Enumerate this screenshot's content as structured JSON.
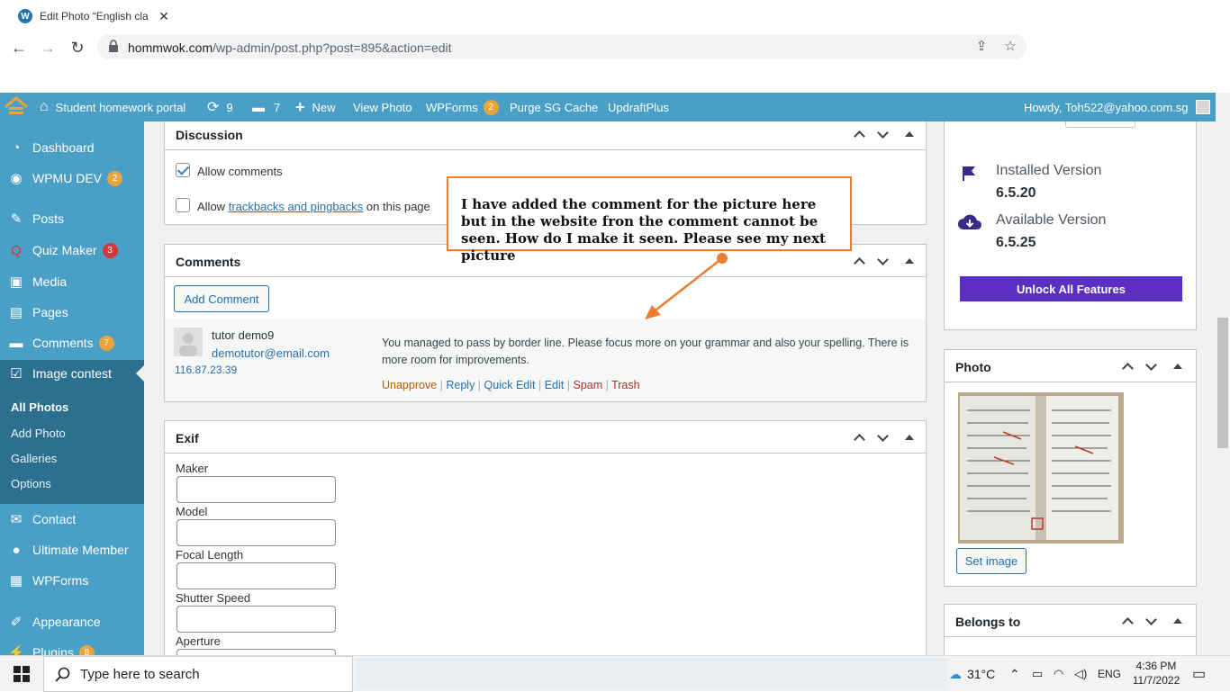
{
  "browser": {
    "tab_title": "Edit Photo “English cla",
    "url_host": "hommwok.com",
    "url_path": "/wp-admin/post.php?post=895&action=edit"
  },
  "adminbar": {
    "site_name": "Student homework portal",
    "updates_count": "9",
    "comments_count": "7",
    "new_label": "New",
    "view_photo": "View Photo",
    "wpforms": "WPForms",
    "wpforms_badge": "2",
    "purge": "Purge SG Cache",
    "updraft": "UpdraftPlus",
    "howdy": "Howdy, Toh522@yahoo.com.sg"
  },
  "sidebar": {
    "items": [
      {
        "label": "Dashboard",
        "icon": "dashboard-icon"
      },
      {
        "label": "WPMU DEV",
        "icon": "wpmudev-icon",
        "badge": "2"
      },
      {
        "label": "Posts",
        "icon": "pin-icon"
      },
      {
        "label": "Quiz Maker",
        "icon": "quiz-icon",
        "badge": "3"
      },
      {
        "label": "Media",
        "icon": "media-icon"
      },
      {
        "label": "Pages",
        "icon": "pages-icon"
      },
      {
        "label": "Comments",
        "icon": "comment-icon",
        "badge": "7"
      },
      {
        "label": "Image contest",
        "icon": "check-icon"
      },
      {
        "label": "Contact",
        "icon": "mail-icon"
      },
      {
        "label": "Ultimate Member",
        "icon": "user-icon"
      },
      {
        "label": "WPForms",
        "icon": "form-icon"
      },
      {
        "label": "Appearance",
        "icon": "brush-icon"
      },
      {
        "label": "Plugins",
        "icon": "plugin-icon",
        "badge": "8"
      }
    ],
    "submenu": [
      "All Photos",
      "Add Photo",
      "Galleries",
      "Options"
    ]
  },
  "discussion": {
    "title": "Discussion",
    "allow_comments": "Allow comments",
    "allow_trackbacks_pre": "Allow",
    "allow_trackbacks_link": "trackbacks and pingbacks",
    "allow_trackbacks_post": "on this page"
  },
  "comments": {
    "title": "Comments",
    "add_button": "Add Comment",
    "author": "tutor demo9",
    "email": "demotutor@email.com",
    "ip": "116.87.23.39",
    "text": "You managed to pass by border line. Please focus more on your grammar and also your spelling. There is more room for improvements.",
    "actions": {
      "unapprove": "Unapprove",
      "reply": "Reply",
      "quick_edit": "Quick Edit",
      "edit": "Edit",
      "spam": "Spam",
      "trash": "Trash"
    }
  },
  "exif": {
    "title": "Exif",
    "fields": [
      "Maker",
      "Model",
      "Focal Length",
      "Shutter Speed",
      "Aperture"
    ]
  },
  "annotation": "I have added the comment for the picture here but in the website fron the comment cannot be seen. How do I make it seen. Please see my next picture",
  "version_box": {
    "installed_label": "Installed Version",
    "installed_value": "6.5.20",
    "available_label": "Available Version",
    "available_value": "6.5.25",
    "unlock_button": "Unlock All Features"
  },
  "photo_box": {
    "title": "Photo",
    "set_image": "Set image"
  },
  "belongs_box": {
    "title": "Belongs to"
  },
  "taskbar": {
    "search_placeholder": "Type here to search",
    "temperature": "31°C",
    "language": "ENG",
    "time": "4:36 PM",
    "date": "11/7/2022"
  }
}
